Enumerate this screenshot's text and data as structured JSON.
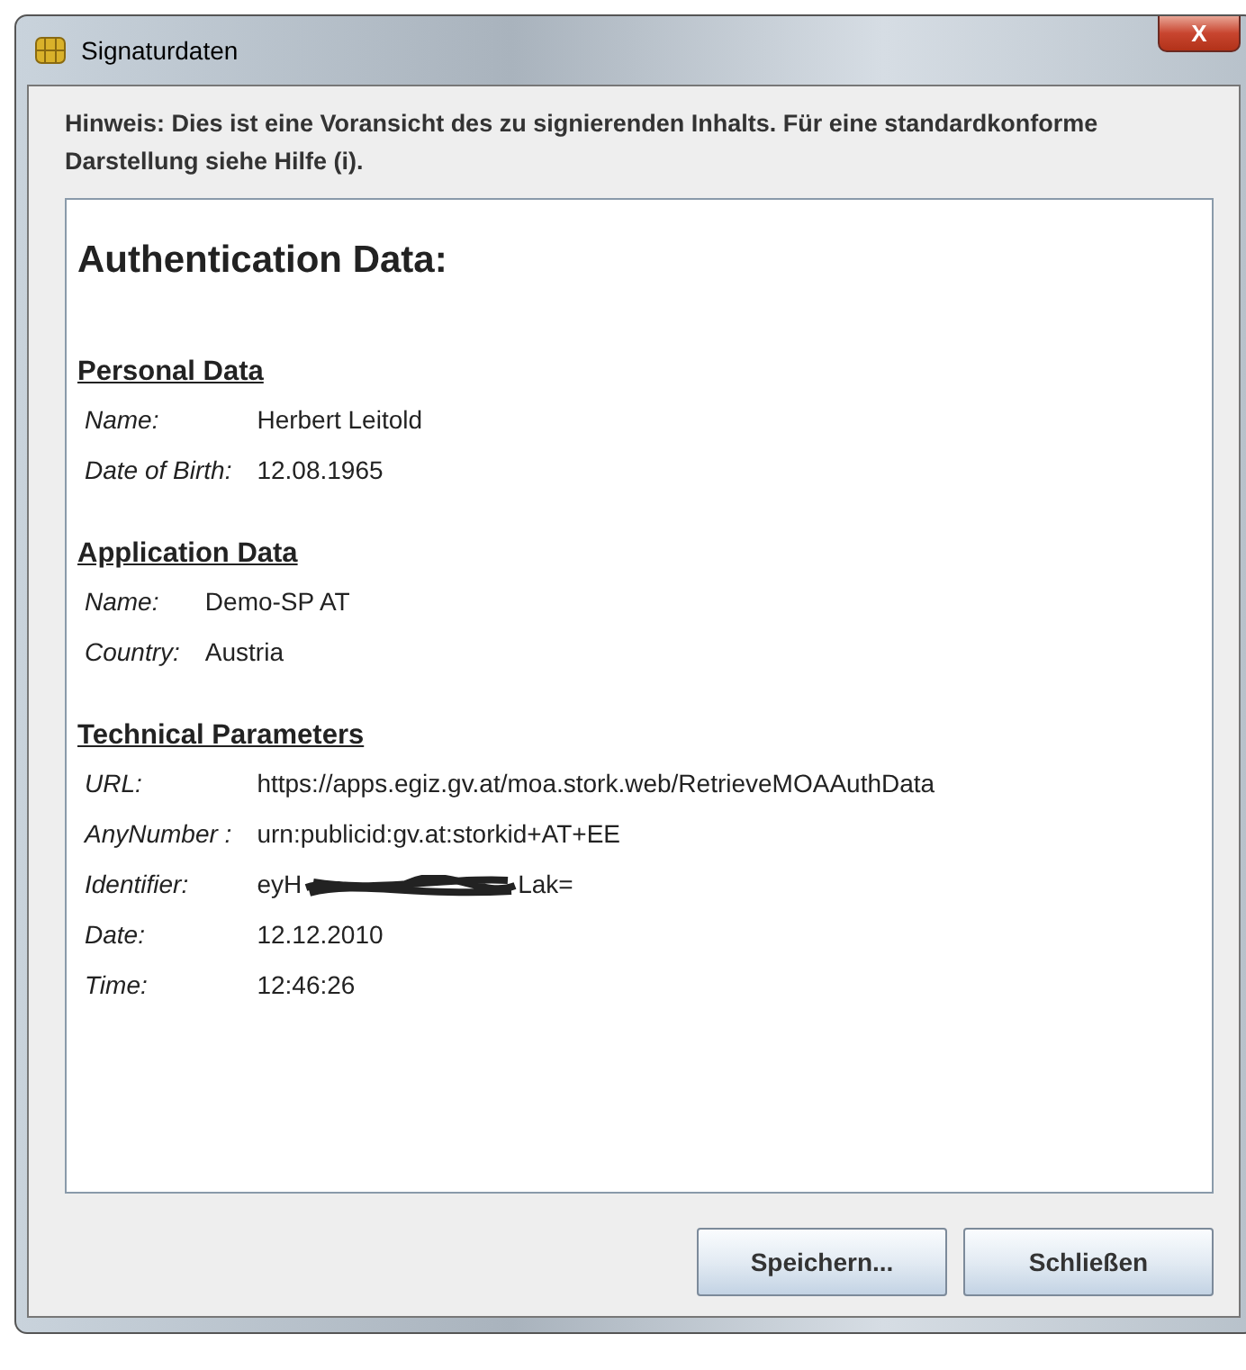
{
  "window": {
    "title": "Signaturdaten",
    "close_label": "X"
  },
  "hint": "Hinweis: Dies ist eine Voransicht des zu signierenden Inhalts. Für eine standardkonforme Darstellung siehe Hilfe (i).",
  "heading": "Authentication Data:",
  "sections": [
    {
      "title": "Personal Data",
      "rows": [
        {
          "label": "Name:",
          "value": "Herbert Leitold"
        },
        {
          "label": "Date of Birth:",
          "value": "12.08.1965"
        }
      ]
    },
    {
      "title": "Application Data",
      "rows": [
        {
          "label": "Name:",
          "value": "Demo-SP AT"
        },
        {
          "label": "Country:",
          "value": "Austria"
        }
      ]
    },
    {
      "title": "Technical Parameters",
      "rows": [
        {
          "label": "URL:",
          "value": "https://apps.egiz.gv.at/moa.stork.web/RetrieveMOAAuthData"
        },
        {
          "label": "AnyNumber :",
          "value": "urn:publicid:gv.at:storkid+AT+EE"
        },
        {
          "label": "Identifier:",
          "value": "eyH",
          "value_end": "Lak=",
          "redacted": true
        },
        {
          "label": "Date:",
          "value": "12.12.2010"
        },
        {
          "label": "Time:",
          "value": "12:46:26"
        }
      ]
    }
  ],
  "buttons": [
    "Speichern...",
    "Schließen"
  ]
}
